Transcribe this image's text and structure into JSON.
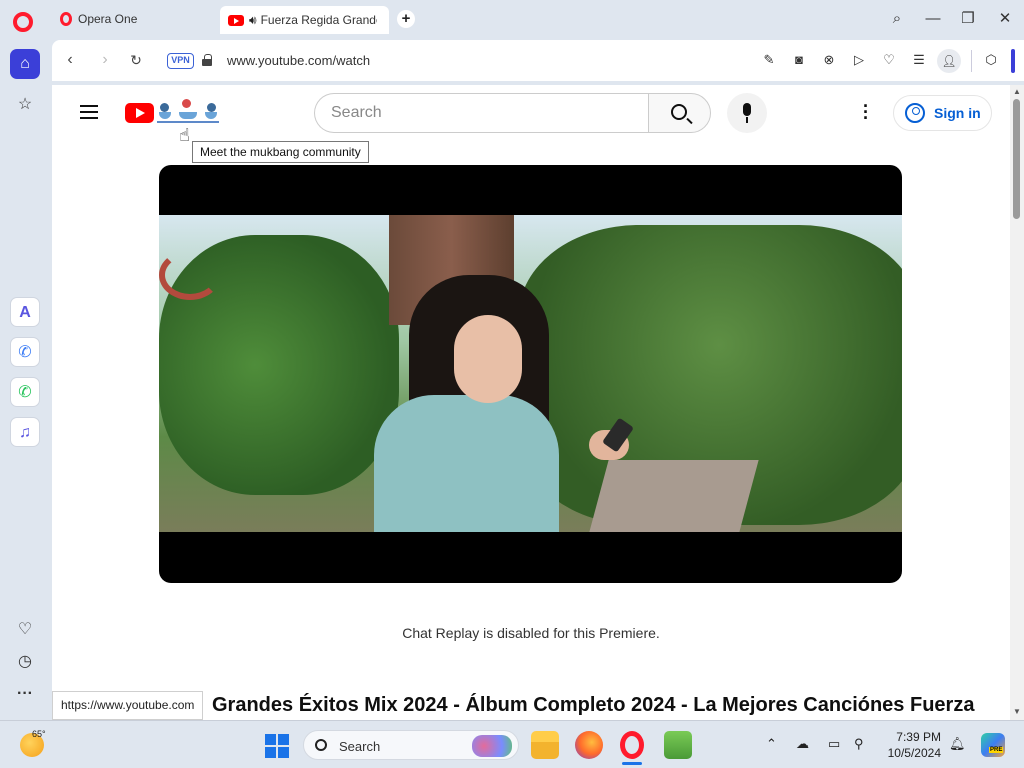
{
  "browser": {
    "tabs": [
      {
        "label": "Opera One"
      },
      {
        "label": "Fuerza Regida Grandes"
      }
    ],
    "new_tab": "+",
    "address": {
      "vpn": "VPN",
      "url": "www.youtube.com/watch"
    },
    "status_url": "https://www.youtube.com"
  },
  "youtube": {
    "search_placeholder": "Search",
    "doodle_tooltip": "Meet the mukbang community",
    "sign_in": "Sign in",
    "chat_replay": "Chat Replay is disabled for this Premiere.",
    "video_title": "Grandes Éxitos Mix 2024 - Álbum Completo 2024 - La Mejores Canciónes Fuerza"
  },
  "taskbar": {
    "temperature": "65°",
    "search_label": "Search",
    "time": "7:39 PM",
    "date": "10/5/2024",
    "copilot_badge": "PRE"
  },
  "icons": [
    "opera-icon",
    "home-icon",
    "star-icon",
    "aria-icon",
    "messenger-icon",
    "whatsapp-icon",
    "music-icon",
    "heart-icon",
    "history-icon",
    "more-icon"
  ]
}
